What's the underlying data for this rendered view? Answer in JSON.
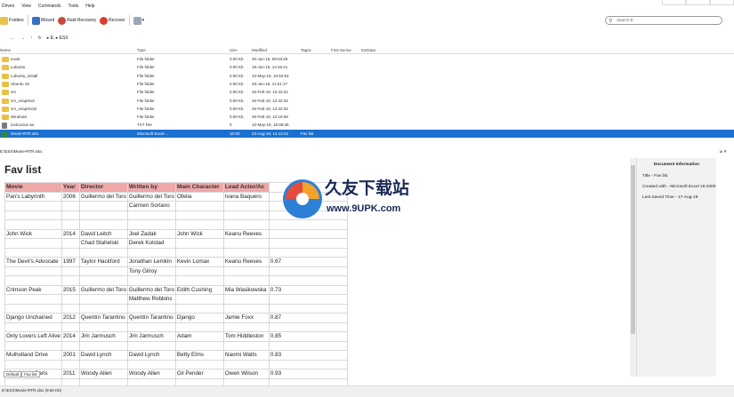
{
  "menu": [
    "Drives",
    "View",
    "Commands",
    "Tools",
    "Help"
  ],
  "toolbar": {
    "folders": "Folders",
    "wizard": "Wizard",
    "raid": "Raid Recovery",
    "recover": "Recover"
  },
  "search_placeholder": "Search E:",
  "address": {
    "drive": "E:",
    "folder": "ESX"
  },
  "columns": [
    "Name",
    "Type",
    "Size",
    "Modified",
    "Tags1",
    "First Sector",
    "ExtData"
  ],
  "files": [
    {
      "name": "esxi6",
      "type": "File folder",
      "size": "0.00 Kb",
      "modified": "20-Jun-16, 09:03:29",
      "tags": ""
    },
    {
      "name": "Lubuntu",
      "type": "File folder",
      "size": "0.00 Kb",
      "modified": "18-Jun-16, 14:46:41",
      "tags": ""
    },
    {
      "name": "Lubuntu_install",
      "type": "File folder",
      "size": "0.00 Kb",
      "modified": "10-May-19, 10:52:53",
      "tags": ""
    },
    {
      "name": "Ubuntu 18",
      "type": "File folder",
      "size": "0.00 Kb",
      "modified": "29-Jun-16, 11:51:17",
      "tags": ""
    },
    {
      "name": "vm",
      "type": "File folder",
      "size": "0.00 Kb",
      "modified": "26-Feb-19, 12:42:24",
      "tags": ""
    },
    {
      "name": "vm_snapshot",
      "type": "File folder",
      "size": "0.00 Kb",
      "modified": "26-Feb-19, 12:42:25",
      "tags": ""
    },
    {
      "name": "vm_snapshot2",
      "type": "File folder",
      "size": "0.00 Kb",
      "modified": "26-Feb-19, 12:42:25",
      "tags": ""
    },
    {
      "name": "Windows",
      "type": "File folder",
      "size": "0.00 Kb",
      "modified": "26-Feb-19, 12:18:59",
      "tags": ""
    },
    {
      "name": "instruction.txt",
      "type": "TXT File",
      "size": "0",
      "modified": "10-May-19, 18:09:35",
      "tags": ""
    },
    {
      "name": "Movie-RTR.xlsx",
      "type": "Microsoft Excel ...",
      "size": "10 Kb",
      "modified": "23-Aug-19, 14:12:42",
      "tags": "Fav list"
    }
  ],
  "preview_path": "E:\\ESX\\Movie-RTR.xlsx",
  "sheet": {
    "title": "Fav list",
    "headers": [
      "Movie",
      "Year",
      "Director",
      "Written by",
      "Main Character",
      "Lead Actor/Ac"
    ],
    "rows": [
      [
        "Pan's Labyrinth",
        "2006",
        "Guillermo del Toro",
        "Guillermo del Toro",
        "Ofelia",
        "Ivana Baquero",
        ""
      ],
      [
        "",
        "",
        "",
        "Carmen Soriano",
        "",
        "",
        ""
      ],
      [
        "",
        "",
        "",
        "",
        "",
        "",
        ""
      ],
      [
        "",
        "",
        "",
        "",
        "",
        "",
        ""
      ],
      [
        "John Wick",
        "2014",
        "David Leitch",
        "Joel Zadak",
        "John Wick",
        "Keanu Reeves",
        ""
      ],
      [
        "",
        "",
        "Chad Stahelski",
        "Derek Kolstad",
        "",
        "",
        ""
      ],
      [
        "",
        "",
        "",
        "",
        "",
        "",
        ""
      ],
      [
        "The Devil's Advocate",
        "1997",
        "Taylor Hackford",
        "Jonathan Lemkin",
        "Kevin Lomax",
        "Keanu Reeves",
        "0.67"
      ],
      [
        "",
        "",
        "",
        "Tony Gilroy",
        "",
        "",
        ""
      ],
      [
        "",
        "",
        "",
        "",
        "",
        "",
        ""
      ],
      [
        "Crimson Peak",
        "2015",
        "Guillermo del Toro",
        "Guillermo del Toro",
        "Edith Cushing",
        "Mia Wasikowska",
        "0.73"
      ],
      [
        "",
        "",
        "",
        "Matthew Robbins",
        "",
        "",
        ""
      ],
      [
        "",
        "",
        "",
        "",
        "",
        "",
        ""
      ],
      [
        "Django Unchained",
        "2012",
        "Quentin Tarantino",
        "Quentin Tarantino",
        "Django",
        "Jamie Foxx",
        "0.87"
      ],
      [
        "",
        "",
        "",
        "",
        "",
        "",
        ""
      ],
      [
        "Only Lovers Left Alive",
        "2014",
        "Jim Jarmusch",
        "Jim Jarmusch",
        "Adam",
        "Tom Hiddleston",
        "0.85"
      ],
      [
        "",
        "",
        "",
        "",
        "",
        "",
        ""
      ],
      [
        "Mulholland Drive",
        "2001",
        "David Lynch",
        "David Lynch",
        "Betty Elms",
        "Naomi Watts",
        "0.83"
      ],
      [
        "",
        "",
        "",
        "",
        "",
        "",
        ""
      ],
      [
        "Midnight in Paris",
        "2011",
        "Woody Allen",
        "Woody Allen",
        "Gil Pender",
        "Owen Wilson",
        "0.93"
      ],
      [
        "",
        "",
        "",
        "",
        "",
        "",
        ""
      ]
    ]
  },
  "docinfo": {
    "title": "Document Information",
    "line1": "Title - Fav list",
    "line2": "Created with - Microsoft Excel 16.0300",
    "line3": "Last Saved Time - 17-Aug-19"
  },
  "tabs": [
    "Default",
    "Fav list"
  ],
  "status": "E:\\ESX\\Movie-RTR.xlsx (9.60 Kb)",
  "watermark": {
    "text": "久友下载站",
    "url": "www.9UPK.com"
  }
}
